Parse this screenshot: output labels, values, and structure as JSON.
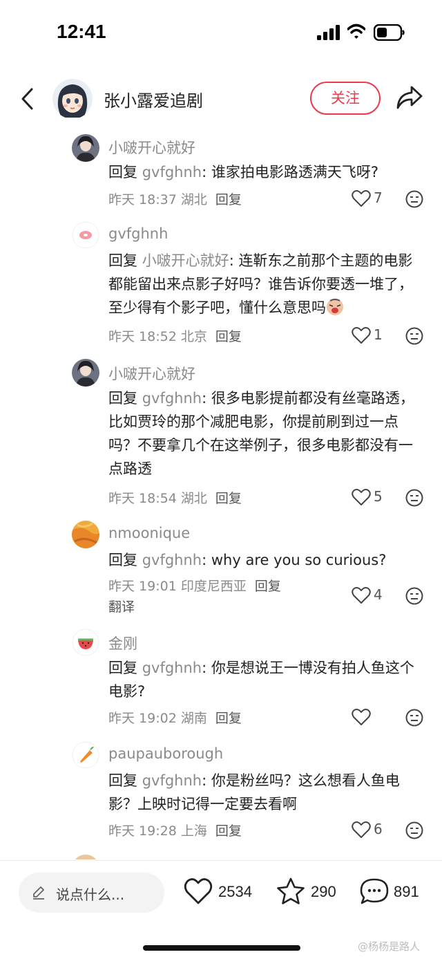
{
  "status_bar": {
    "time": "12:41"
  },
  "header": {
    "author_name": "张小露爱追剧",
    "follow_label": "关注"
  },
  "comments": [
    {
      "name": "小啵开心就好",
      "reply_prefix": "回复 ",
      "reply_to": "gvfghnh",
      "text": ": 谁家拍电影路透满天飞呀?",
      "time": "昨天 18:37",
      "location": "湖北",
      "reply_label": "回复",
      "likes": "7"
    },
    {
      "name": "gvfghnh",
      "reply_prefix": "回复 ",
      "reply_to": "小啵开心就好",
      "text": ": 连靳东之前那个主题的电影都能留出来点影子好吗？谁告诉你要透一堆了，至少得有个影子吧，懂什么意思吗",
      "time": "昨天 18:52",
      "location": "北京",
      "reply_label": "回复",
      "likes": "1"
    },
    {
      "name": "小啵开心就好",
      "reply_prefix": "回复 ",
      "reply_to": "gvfghnh",
      "text": ": 很多电影提前都没有丝毫路透，比如贾玲的那个减肥电影，你提前刷到过一点吗？不要拿几个在这举例子，很多电影都没有一点路透",
      "time": "昨天 18:54",
      "location": "湖北",
      "reply_label": "回复",
      "likes": "5"
    },
    {
      "name": "nmoonique",
      "reply_prefix": "回复 ",
      "reply_to": "gvfghnh",
      "text": ": why are you so curious?",
      "time": "昨天 19:01",
      "location": "印度尼西亚",
      "reply_label": "回复",
      "translate_label": "翻译",
      "likes": "4"
    },
    {
      "name": "金刚",
      "reply_prefix": "回复 ",
      "reply_to": "gvfghnh",
      "text": ": 你是想说王一博没有拍人鱼这个电影?",
      "time": "昨天 19:02",
      "location": "湖南",
      "reply_label": "回复",
      "likes": ""
    },
    {
      "name": "paupauborough",
      "reply_prefix": "回复 ",
      "reply_to": "gvfghnh",
      "text": ": 你是粉丝吗？这么想看人鱼电影？上映时记得一定要去看啊",
      "time": "昨天 19:28",
      "location": "上海",
      "reply_label": "回复",
      "likes": "6"
    }
  ],
  "bottom_bar": {
    "input_placeholder": "说点什么...",
    "likes_count": "2534",
    "favorites_count": "290",
    "comments_count": "891"
  },
  "watermark": "@杨杨是路人",
  "colors": {
    "accent_red": "#f0384b",
    "secondary_text": "#8a8a8a"
  },
  "icons": [
    "back-icon",
    "share-icon",
    "heart-icon",
    "neutral-face-icon",
    "pencil-icon",
    "star-icon",
    "chat-bubble-icon"
  ]
}
